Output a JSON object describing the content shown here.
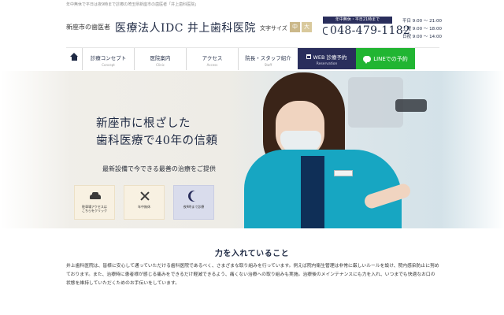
{
  "topbar": {
    "text": "年中無休で平日は夜9時まで診療の埼玉県新座市の歯医者「井上歯科医院」"
  },
  "header": {
    "tagline": "新座市の歯医者",
    "clinic_name": "医療法人IDC 井上歯科医院",
    "fontsize_label": "文字サイズ",
    "fontsize_mid": "中",
    "fontsize_big": "大",
    "hours_badge": "年中無休・平日21時まで",
    "phone": "048-479-1182",
    "hours_weekday": "平日 9:00 ～ 21:00",
    "hours_saturday": "土曜 9:00 ～ 18:00",
    "hours_holiday": "日祝 9:00 ～ 14:00"
  },
  "nav": {
    "items": [
      {
        "ja": "診療コンセプト",
        "en": "Concept"
      },
      {
        "ja": "医院案内",
        "en": "Clinic"
      },
      {
        "ja": "アクセス",
        "en": "Access"
      },
      {
        "ja": "院長・スタッフ紹介",
        "en": "Staff"
      }
    ],
    "web": {
      "ja": "WEB 診療予約",
      "en": "Reservation"
    },
    "line": "LINEでの予約"
  },
  "hero": {
    "headline_1": "新座市に根ざした",
    "headline_2": "歯科医療で40年の信頼",
    "sub": "最新設備で今できる最善の治療をご提供",
    "features": [
      {
        "line1": "駐車場アクセスは",
        "line2": "こちらをクリック"
      },
      {
        "line1": "年中無休",
        "line2": ""
      },
      {
        "line1": "夜9時まで診療",
        "line2": ""
      }
    ]
  },
  "section": {
    "title": "力を入れていること",
    "body": "井上歯科医院は、皆様に安心して通っていただける歯科医院であるべく、さまざまな取り組みを行っています。例えば院内衛生管理は非常に厳しいルールを設け、院内感染防止に努めております。また、治療時に患者様が感じる痛みをできるだけ軽減できるよう、痛くない治療への取り組みも実施。治療後のメインテナンスにも力を入れ、いつまでも快適なお口の状態を維持していただくためのお手伝いをしています。"
  }
}
